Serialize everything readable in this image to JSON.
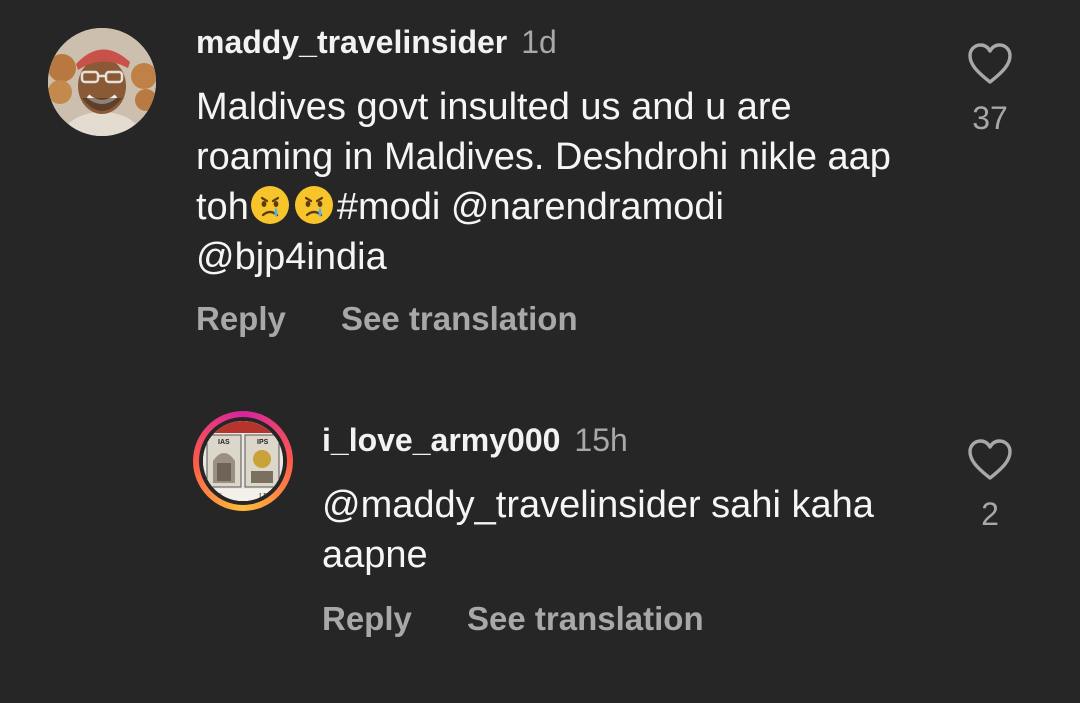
{
  "comments": [
    {
      "username": "maddy_travelinsider",
      "time": "1d",
      "text_part1": "Maldives govt insulted us and u are roaming in Maldives. Deshdrohi nikle aap toh",
      "text_part2": "#modi @narendramodi @bjp4india",
      "emoji": "crying-face-icon",
      "reply_label": "Reply",
      "translate_label": "See translation",
      "like_count": "37"
    },
    {
      "username": "i_love_army000",
      "time": "15h",
      "text": "@maddy_travelinsider sahi kaha aapne",
      "avatar_labels": [
        "IAS",
        "IPS",
        "AS",
        "I.P"
      ],
      "reply_label": "Reply",
      "translate_label": "See translation",
      "like_count": "2"
    }
  ],
  "colors": {
    "background": "#262626",
    "text": "#f5f5f5",
    "secondary": "#a8a8a8"
  }
}
